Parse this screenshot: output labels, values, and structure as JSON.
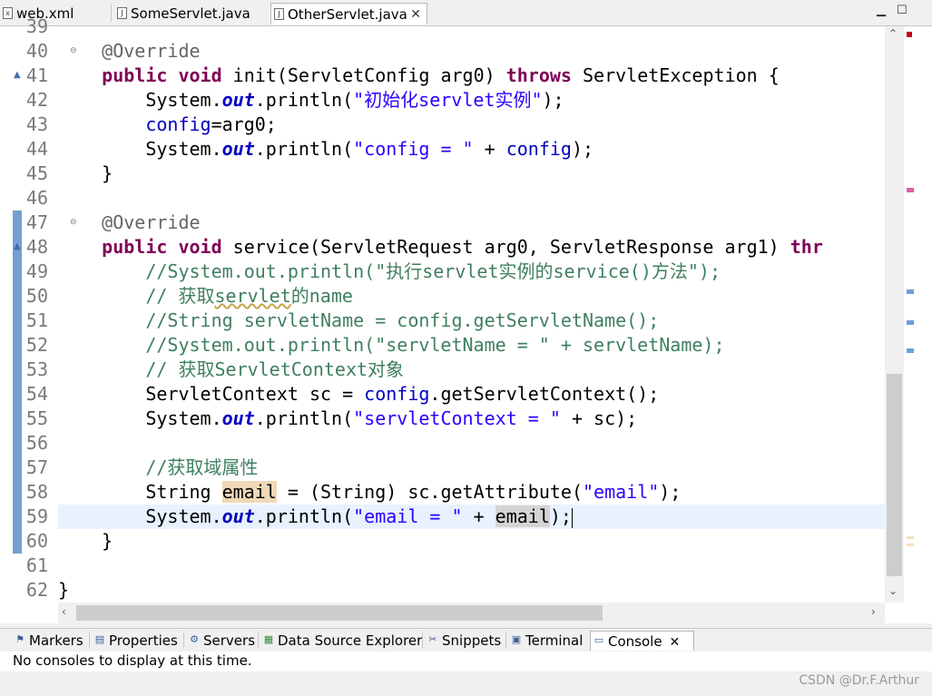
{
  "editor_tabs": [
    {
      "label": "web.xml",
      "icon": "xml-file-icon"
    },
    {
      "label": "SomeServlet.java",
      "icon": "java-file-icon"
    },
    {
      "label": "OtherServlet.java",
      "icon": "java-file-icon",
      "active": true
    }
  ],
  "line_numbers": [
    "39",
    "40",
    "41",
    "42",
    "43",
    "44",
    "45",
    "46",
    "47",
    "48",
    "49",
    "50",
    "51",
    "52",
    "53",
    "54",
    "55",
    "56",
    "57",
    "58",
    "59",
    "60",
    "61",
    "62"
  ],
  "code": {
    "l40": "@Override",
    "l41_kw1": "public void",
    "l41_a": " init(ServletConfig arg0) ",
    "l41_kw2": "throws",
    "l41_b": " ServletException {",
    "l42_a": "System.",
    "l42_out": "out",
    "l42_b": ".println(",
    "l42_str": "\"初始化servlet实例\"",
    "l42_c": ");",
    "l43_fld": "config",
    "l43_b": "=arg0;",
    "l44_a": "System.",
    "l44_out": "out",
    "l44_b": ".println(",
    "l44_str": "\"config = \"",
    "l44_c": " + ",
    "l44_fld": "config",
    "l44_d": ");",
    "l45": "}",
    "l47": "@Override",
    "l48_kw": "public void",
    "l48_a": " service(ServletRequest arg0, ServletResponse arg1) ",
    "l48_kw2": "thr",
    "l49": "//System.out.println(\"执行servlet实例的service()方法\");",
    "l50_a": "// 获取",
    "l50_sq": "servlet",
    "l50_b": "的name",
    "l51": "//String servletName = config.getServletName();",
    "l52": "//System.out.println(\"servletName = \" + servletName);",
    "l53": "// 获取ServletContext对象",
    "l54_a": "ServletContext sc = ",
    "l54_fld": "config",
    "l54_b": ".getServletContext();",
    "l55_a": "System.",
    "l55_out": "out",
    "l55_b": ".println(",
    "l55_str": "\"servletContext = \"",
    "l55_c": " + sc);",
    "l57": "//获取域属性",
    "l58_a": "String ",
    "l58_hl": "email",
    "l58_b": " = (String) sc.getAttribute(",
    "l58_str": "\"email\"",
    "l58_c": ");",
    "l59_a": "System.",
    "l59_out": "out",
    "l59_b": ".println(",
    "l59_str": "\"email = \"",
    "l59_c": " + ",
    "l59_hl": "email",
    "l59_d": ");",
    "l60": "}",
    "l62": "}"
  },
  "view_tabs": [
    {
      "label": "Markers",
      "icon": "markers-icon"
    },
    {
      "label": "Properties",
      "icon": "properties-icon"
    },
    {
      "label": "Servers",
      "icon": "servers-icon"
    },
    {
      "label": "Data Source Explorer",
      "icon": "data-source-icon"
    },
    {
      "label": "Snippets",
      "icon": "snippets-icon"
    },
    {
      "label": "Terminal",
      "icon": "terminal-icon"
    },
    {
      "label": "Console",
      "icon": "console-icon",
      "active": true
    }
  ],
  "console_message": "No consoles to display at this time.",
  "watermark": "CSDN @Dr.F.Arthur",
  "colors": {
    "keyword": "#7f0055",
    "string": "#2a00ff",
    "comment": "#3f7f5f",
    "field": "#0000c0",
    "annotation": "#646464",
    "current_line": "#e8f2fe"
  }
}
